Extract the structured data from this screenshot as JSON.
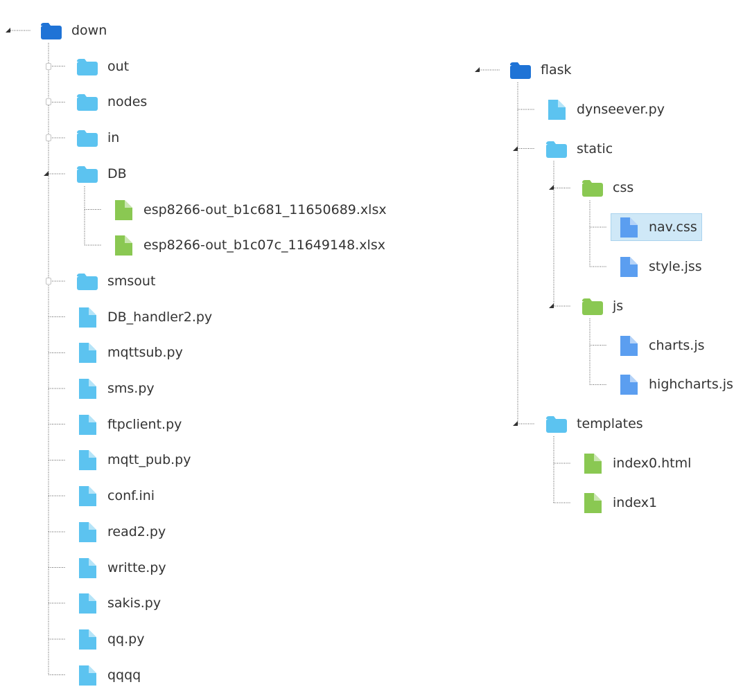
{
  "colors": {
    "folder_root": "#1f73d6",
    "folder": "#5cc3f0",
    "folder_green": "#8ac852",
    "file_light_blue": "#5cc3f0",
    "file_blue": "#5b9ef0",
    "file_green": "#8ac852",
    "selected_bg": "#cfe8f7"
  },
  "trees": [
    {
      "root": {
        "label": "down",
        "icon": "folder-root-icon",
        "expanded": true
      },
      "children": [
        {
          "label": "out",
          "icon": "folder-icon",
          "type": "folder",
          "expanded": false
        },
        {
          "label": "nodes",
          "icon": "folder-icon",
          "type": "folder",
          "expanded": false
        },
        {
          "label": "in",
          "icon": "folder-icon",
          "type": "folder",
          "expanded": false
        },
        {
          "label": "DB",
          "icon": "folder-icon",
          "type": "folder",
          "expanded": true,
          "children": [
            {
              "label": "esp8266-out_b1c681_11650689.xlsx",
              "icon": "file-green-icon",
              "type": "file"
            },
            {
              "label": "esp8266-out_b1c07c_11649148.xlsx",
              "icon": "file-green-icon",
              "type": "file"
            }
          ]
        },
        {
          "label": "smsout",
          "icon": "folder-icon",
          "type": "folder",
          "expanded": false
        },
        {
          "label": "DB_handler2.py",
          "icon": "file-icon",
          "type": "file"
        },
        {
          "label": "mqttsub.py",
          "icon": "file-icon",
          "type": "file"
        },
        {
          "label": "sms.py",
          "icon": "file-icon",
          "type": "file"
        },
        {
          "label": "ftpclient.py",
          "icon": "file-icon",
          "type": "file"
        },
        {
          "label": "mqtt_pub.py",
          "icon": "file-icon",
          "type": "file"
        },
        {
          "label": "conf.ini",
          "icon": "file-icon",
          "type": "file"
        },
        {
          "label": "read2.py",
          "icon": "file-icon",
          "type": "file"
        },
        {
          "label": "writte.py",
          "icon": "file-icon",
          "type": "file"
        },
        {
          "label": "sakis.py",
          "icon": "file-icon",
          "type": "file"
        },
        {
          "label": "qq.py",
          "icon": "file-icon",
          "type": "file"
        },
        {
          "label": "qqqq",
          "icon": "file-icon",
          "type": "file"
        }
      ]
    },
    {
      "root": {
        "label": "flask",
        "icon": "folder-root-icon",
        "expanded": true
      },
      "children": [
        {
          "label": "dynseever.py",
          "icon": "file-icon",
          "type": "file"
        },
        {
          "label": "static",
          "icon": "folder-icon",
          "type": "folder",
          "expanded": true,
          "children": [
            {
              "label": "css",
              "icon": "folder-green-icon",
              "type": "folder",
              "expanded": true,
              "children": [
                {
                  "label": "nav.css",
                  "icon": "file-blue-icon",
                  "type": "file",
                  "selected": true
                },
                {
                  "label": "style.jss",
                  "icon": "file-blue-icon",
                  "type": "file"
                }
              ]
            },
            {
              "label": "js",
              "icon": "folder-green-icon",
              "type": "folder",
              "expanded": true,
              "children": [
                {
                  "label": "charts.js",
                  "icon": "file-blue-icon",
                  "type": "file"
                },
                {
                  "label": "highcharts.js",
                  "icon": "file-blue-icon",
                  "type": "file"
                }
              ]
            }
          ]
        },
        {
          "label": "templates",
          "icon": "folder-icon",
          "type": "folder",
          "expanded": true,
          "children": [
            {
              "label": "index0.html",
              "icon": "file-green-icon",
              "type": "file"
            },
            {
              "label": "index1",
              "icon": "file-green-icon",
              "type": "file"
            }
          ]
        }
      ]
    }
  ]
}
